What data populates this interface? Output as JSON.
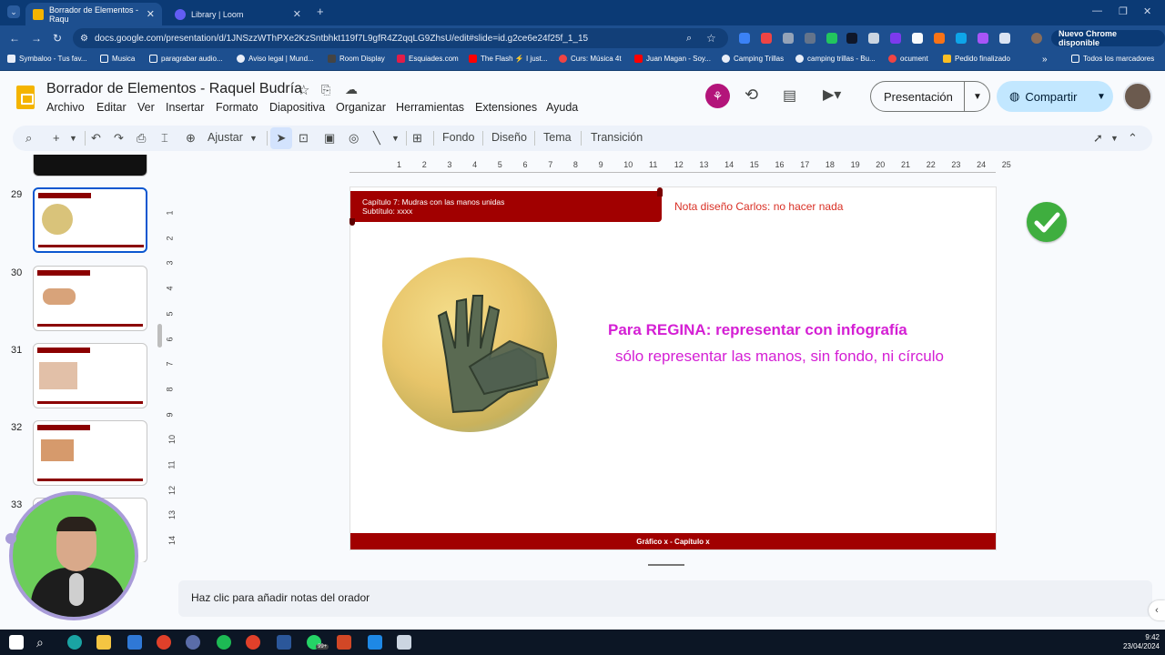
{
  "browser": {
    "tabs": [
      {
        "label": "Borrador de Elementos - Raqu",
        "active": true,
        "color": "#f4b400"
      },
      {
        "label": "Library | Loom",
        "active": false,
        "color": "#625df5"
      }
    ],
    "new_tab": "+",
    "url": "docs.google.com/presentation/d/1JNSzzWThPXe2KzSntbhkt119f7L9gfR4Z2qqLG9ZhsU/edit#slide=id.g2ce6e24f25f_1_15",
    "chrome_badge": "Nuevo Chrome disponible",
    "bookmarks": [
      "Symbaloo - Tus fav...",
      "Musica",
      "paragrabar audio...",
      "Aviso legal | Mund...",
      "Room Display",
      "Esquiades.com",
      "The Flash ⚡ I just...",
      "Curs: Música 4t",
      "Juan Magan - Soy...",
      "Camping Trillas",
      "camping trillas - Bu...",
      "ocument",
      "Pedido finalizado",
      "Todos los marcadores"
    ]
  },
  "app": {
    "title": "Borrador de Elementos - Raquel Budría",
    "menus": [
      "Archivo",
      "Editar",
      "Ver",
      "Insertar",
      "Formato",
      "Diapositiva",
      "Organizar",
      "Herramientas",
      "Extensiones",
      "Ayuda"
    ],
    "present_label": "Presentación",
    "share_label": "Compartir"
  },
  "toolbar": {
    "zoom_label": "Ajustar",
    "background": "Fondo",
    "design": "Diseño",
    "theme": "Tema",
    "transition": "Transición"
  },
  "filmstrip": {
    "slides": [
      {
        "number": "29",
        "selected": true
      },
      {
        "number": "30",
        "selected": false
      },
      {
        "number": "31",
        "selected": false
      },
      {
        "number": "32",
        "selected": false
      },
      {
        "number": "33",
        "selected": false
      }
    ]
  },
  "ruler": {
    "horizontal": [
      "1",
      "2",
      "3",
      "4",
      "5",
      "6",
      "7",
      "8",
      "9",
      "10",
      "11",
      "12",
      "13",
      "14",
      "15",
      "16",
      "17",
      "18",
      "19",
      "20",
      "21",
      "22",
      "23",
      "24",
      "25"
    ],
    "vertical": [
      "1",
      "2",
      "3",
      "4",
      "5",
      "6",
      "7",
      "8",
      "9",
      "10",
      "11",
      "12",
      "13",
      "14"
    ]
  },
  "slide": {
    "chapter_line": "Capítulo 7:  Mudras con las manos unidas",
    "subtitle_line": "Subtítulo:     xxxx",
    "design_note": "Nota diseño Carlos: no hacer nada",
    "heading": "Para REGINA: representar con infografía",
    "subheading": "sólo representar las manos, sin fondo, ni círculo",
    "footer": "Gráfico x - Capítulo x",
    "accent_color": "#a10000",
    "highlight_color": "#d41fd4"
  },
  "notes": {
    "placeholder": "Haz clic para añadir notas del orador"
  },
  "taskbar": {
    "time": "9:42",
    "date": "23/04/2024",
    "badge": "99+"
  }
}
